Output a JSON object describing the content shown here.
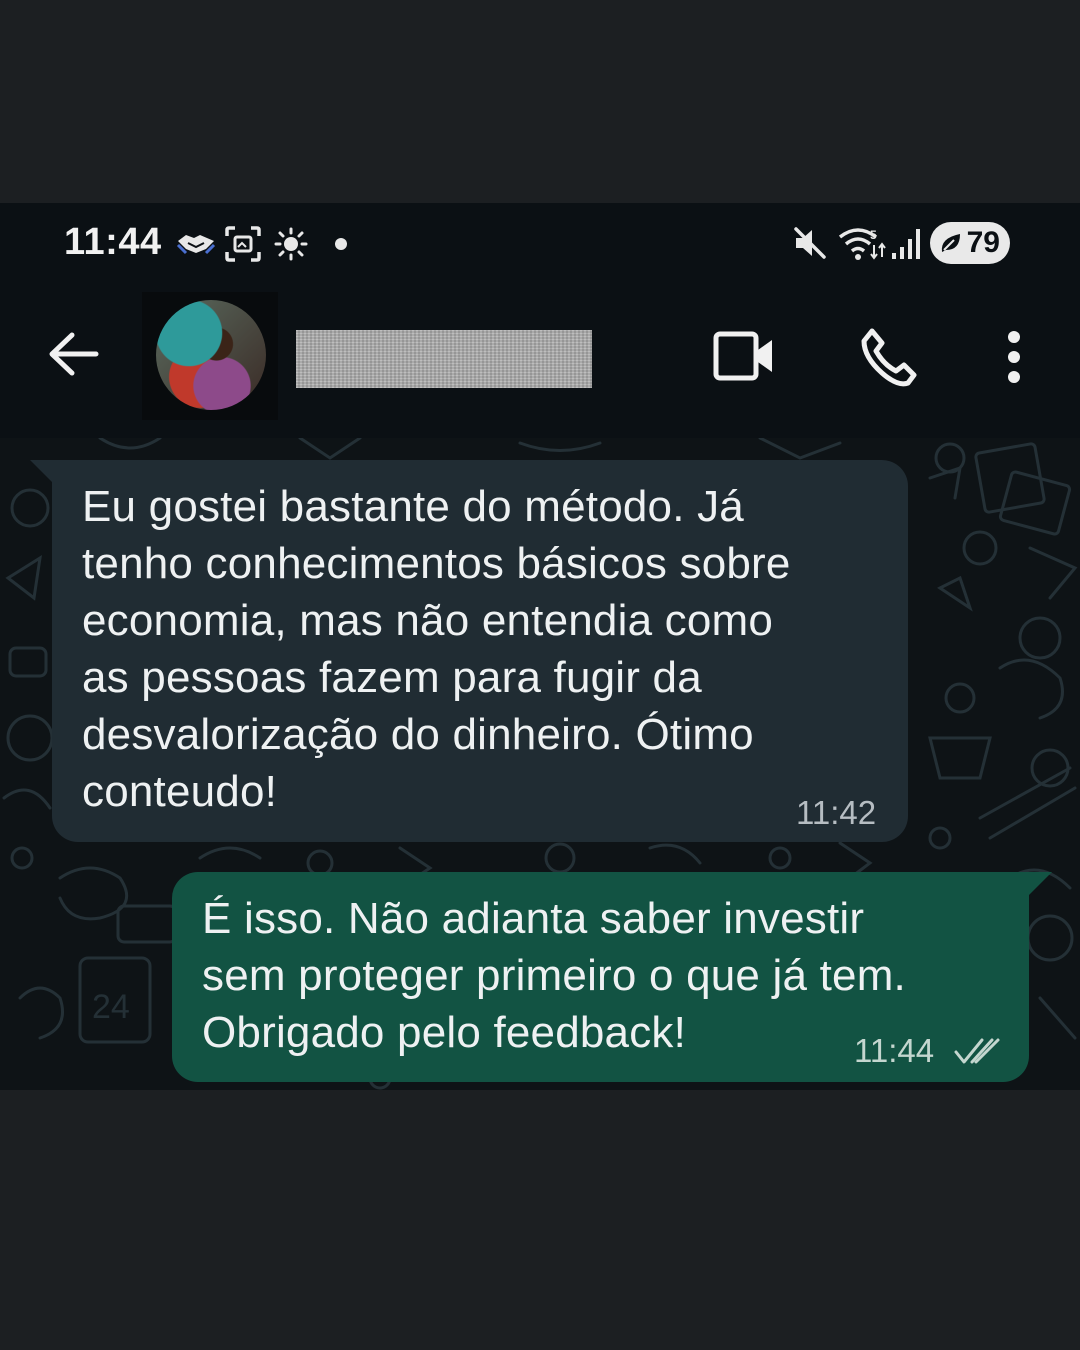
{
  "status_bar": {
    "time": "11:44",
    "icons": [
      "handshake-icon",
      "screenshot-icon",
      "brightness-icon",
      "notification-dot-icon",
      "muted-icon",
      "wifi-icon",
      "signal-icon"
    ],
    "battery": "79"
  },
  "header": {
    "back_icon": "back-arrow-icon",
    "contact_name": "",
    "actions": [
      "video-call-icon",
      "phone-call-icon",
      "more-options-icon"
    ]
  },
  "messages": [
    {
      "direction": "incoming",
      "text": "Eu gostei bastante do método. Já\ntenho conhecimentos básicos sobre\neconomia, mas não entendia como\nas pessoas fazem para fugir da\ndesvalorização do dinheiro. Ótimo\nconteudo!",
      "time": "11:42"
    },
    {
      "direction": "outgoing",
      "text": "É isso. Não adianta saber investir\nsem proteger primeiro o que já tem.\nObrigado pelo feedback!",
      "time": "11:44",
      "status_icon": "double-check-icon"
    }
  ],
  "colors": {
    "incoming_bubble": "#202c33",
    "outgoing_bubble": "#125343",
    "app_background": "#0b1014"
  }
}
